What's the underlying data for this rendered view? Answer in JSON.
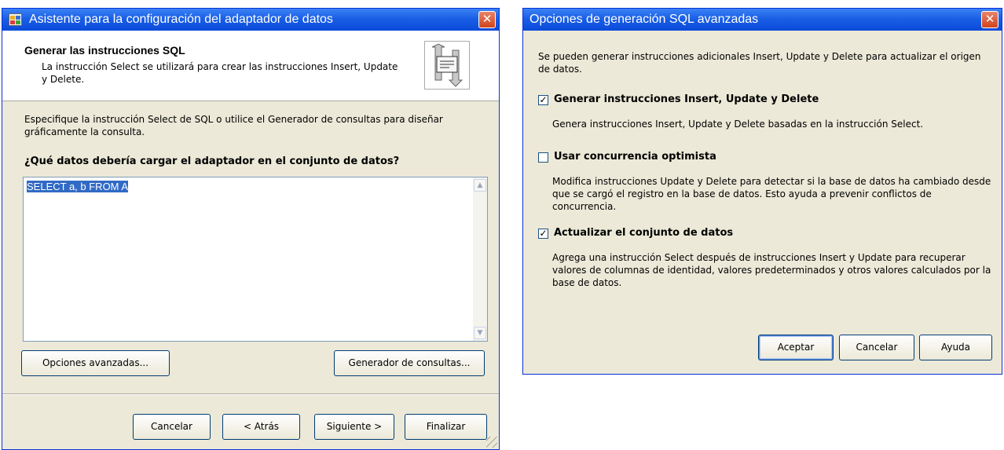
{
  "wizard": {
    "title": "Asistente para la configuración del adaptador de datos",
    "header_title": "Generar las instrucciones SQL",
    "header_subtitle": "La instrucción Select se utilizará para crear las instrucciones Insert, Update y Delete.",
    "intro": "Especifique la instrucción Select de SQL o utilice el Generador de consultas para diseñar gráficamente la consulta.",
    "question": "¿Qué datos debería cargar el adaptador en el conjunto de datos?",
    "sql_text": "SELECT a, b FROM A",
    "advanced_button": "Opciones avanzadas...",
    "query_builder_button": "Generador de consultas...",
    "cancel_button": "Cancelar",
    "back_button": "< Atrás",
    "next_button": "Siguiente >",
    "finish_button": "Finalizar"
  },
  "advanced": {
    "title": "Opciones de generación SQL avanzadas",
    "intro": "Se pueden generar instrucciones adicionales Insert, Update y Delete para actualizar el origen de datos.",
    "options": [
      {
        "label": "Generar instrucciones Insert, Update y Delete",
        "checked": true,
        "description": "Genera instrucciones Insert, Update y Delete basadas en la instrucción Select."
      },
      {
        "label": "Usar concurrencia optimista",
        "checked": false,
        "description": "Modifica instrucciones Update y Delete para detectar si la base de datos ha cambiado desde que se cargó el registro en la base de datos. Esto ayuda a prevenir conflictos de concurrencia."
      },
      {
        "label": "Actualizar el conjunto de datos",
        "checked": true,
        "description": "Agrega una instrucción Select después de instrucciones Insert y Update para recuperar valores de columnas de identidad, valores predeterminados y otros valores calculados por la base de datos."
      }
    ],
    "ok_button": "Aceptar",
    "cancel_button": "Cancelar",
    "help_button": "Ayuda"
  },
  "icons": {
    "close": "close-icon",
    "app": "data-adapter-icon",
    "wizard_graphic": "sql-statement-icon"
  }
}
